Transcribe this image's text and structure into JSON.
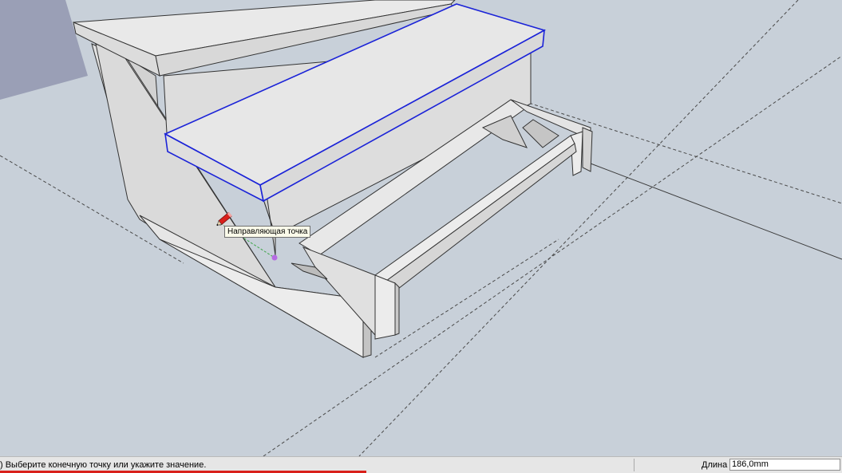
{
  "tooltip": {
    "text": "Направляющая точка"
  },
  "status": {
    "prompt": ") Выберите конечную точку или укажите значение.",
    "measurement_label": "Длина",
    "measurement_value": "186,0mm"
  },
  "colors": {
    "selection": "#1b23d8",
    "inference_point": "#b66ae3",
    "progress": "#d9201b"
  },
  "progress": {
    "fraction": 0.435
  }
}
